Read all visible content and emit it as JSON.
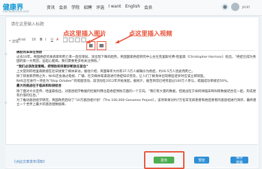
{
  "header": {
    "logo": "健康界",
    "logo_sub": "CN-healthcare.com",
    "nav": [
      "资讯",
      "会员",
      "",
      "",
      "学院",
      "",
      "招聘",
      "",
      "评选",
      "I want",
      "English",
      "会员"
    ],
    "user_name": "JACKY"
  },
  "editor": {
    "title_placeholder": "请在这里输入标题",
    "label": "* 详情:",
    "toolbar": {
      "font": "Arial",
      "size": "16",
      "items": [
        "B",
        "I",
        "U",
        "A"
      ]
    },
    "annotations": {
      "insert_image": "点这里插入图片",
      "insert_video": "点这里插入视频"
    }
  },
  "article": {
    "paragraphs": [
      {
        "bold": true,
        "text": "癌症的未来在预防"
      },
      {
        "bold": false,
        "text": "过去10年，英国癌症的发病率和死亡率一直在增加，没出现下降的趋势。英国国家癌症研究中心主任克里斯托弗·哈里森（Christopher Harrison）指出，“癌症已成为英国的第一大死因，远超心脏病。我们需要更多地关注预防。”"
      },
      {
        "bold": true,
        "text": "“我们必须改变策略，把预防和早期诊断放在首位”"
      },
      {
        "bold": false,
        "text": "上文提到的哈里森教授在近日接受了媒体采访。据他介绍，英国每年大约有37.5万人被确诊为癌症，约16.5万人因此而死亡。"
      },
      {
        "bold": false,
        "text": "除了研发新药物之外，NHS还会通过电视、广播、社交媒体等渠道进行癌症知识普及，让人们了解身体出现哪些症状时应该立即就医。"
      },
      {
        "bold": false,
        "text": "NHS正在进行一项名为“Stop October”的戒烟活动，该活动在2012年开始发起。据统计，截至目前已经有超过100万人参与，戒烟成功率接近50%。"
      },
      {
        "bold": true,
        "text": "最大的挑战在于临床和科研结合"
      },
      {
        "bold": false,
        "text": "除了面对大众宣传，哈里森指出，对基因组学数据的挖掘利用也是癌症预防方面的一个方向。“我们有大量的数据，但挑战在于如何将临床和科研数据结合在一起，形成更有价值的信息。”"
      },
      {
        "bold": false,
        "text": "为了推动基因组学研究，英国政府启动了“10万基因组计划”（The 100,000 Genomes Project），该项目将对约7万名罕见病患者和癌症患者的基因组进行测序，最终建立一个世界上最大的基因组数据库。"
      }
    ]
  },
  "footer": {
    "back_link": "《点此文章发布须知》",
    "publish": "发布",
    "preview": "预览",
    "draft": "保存草稿"
  }
}
